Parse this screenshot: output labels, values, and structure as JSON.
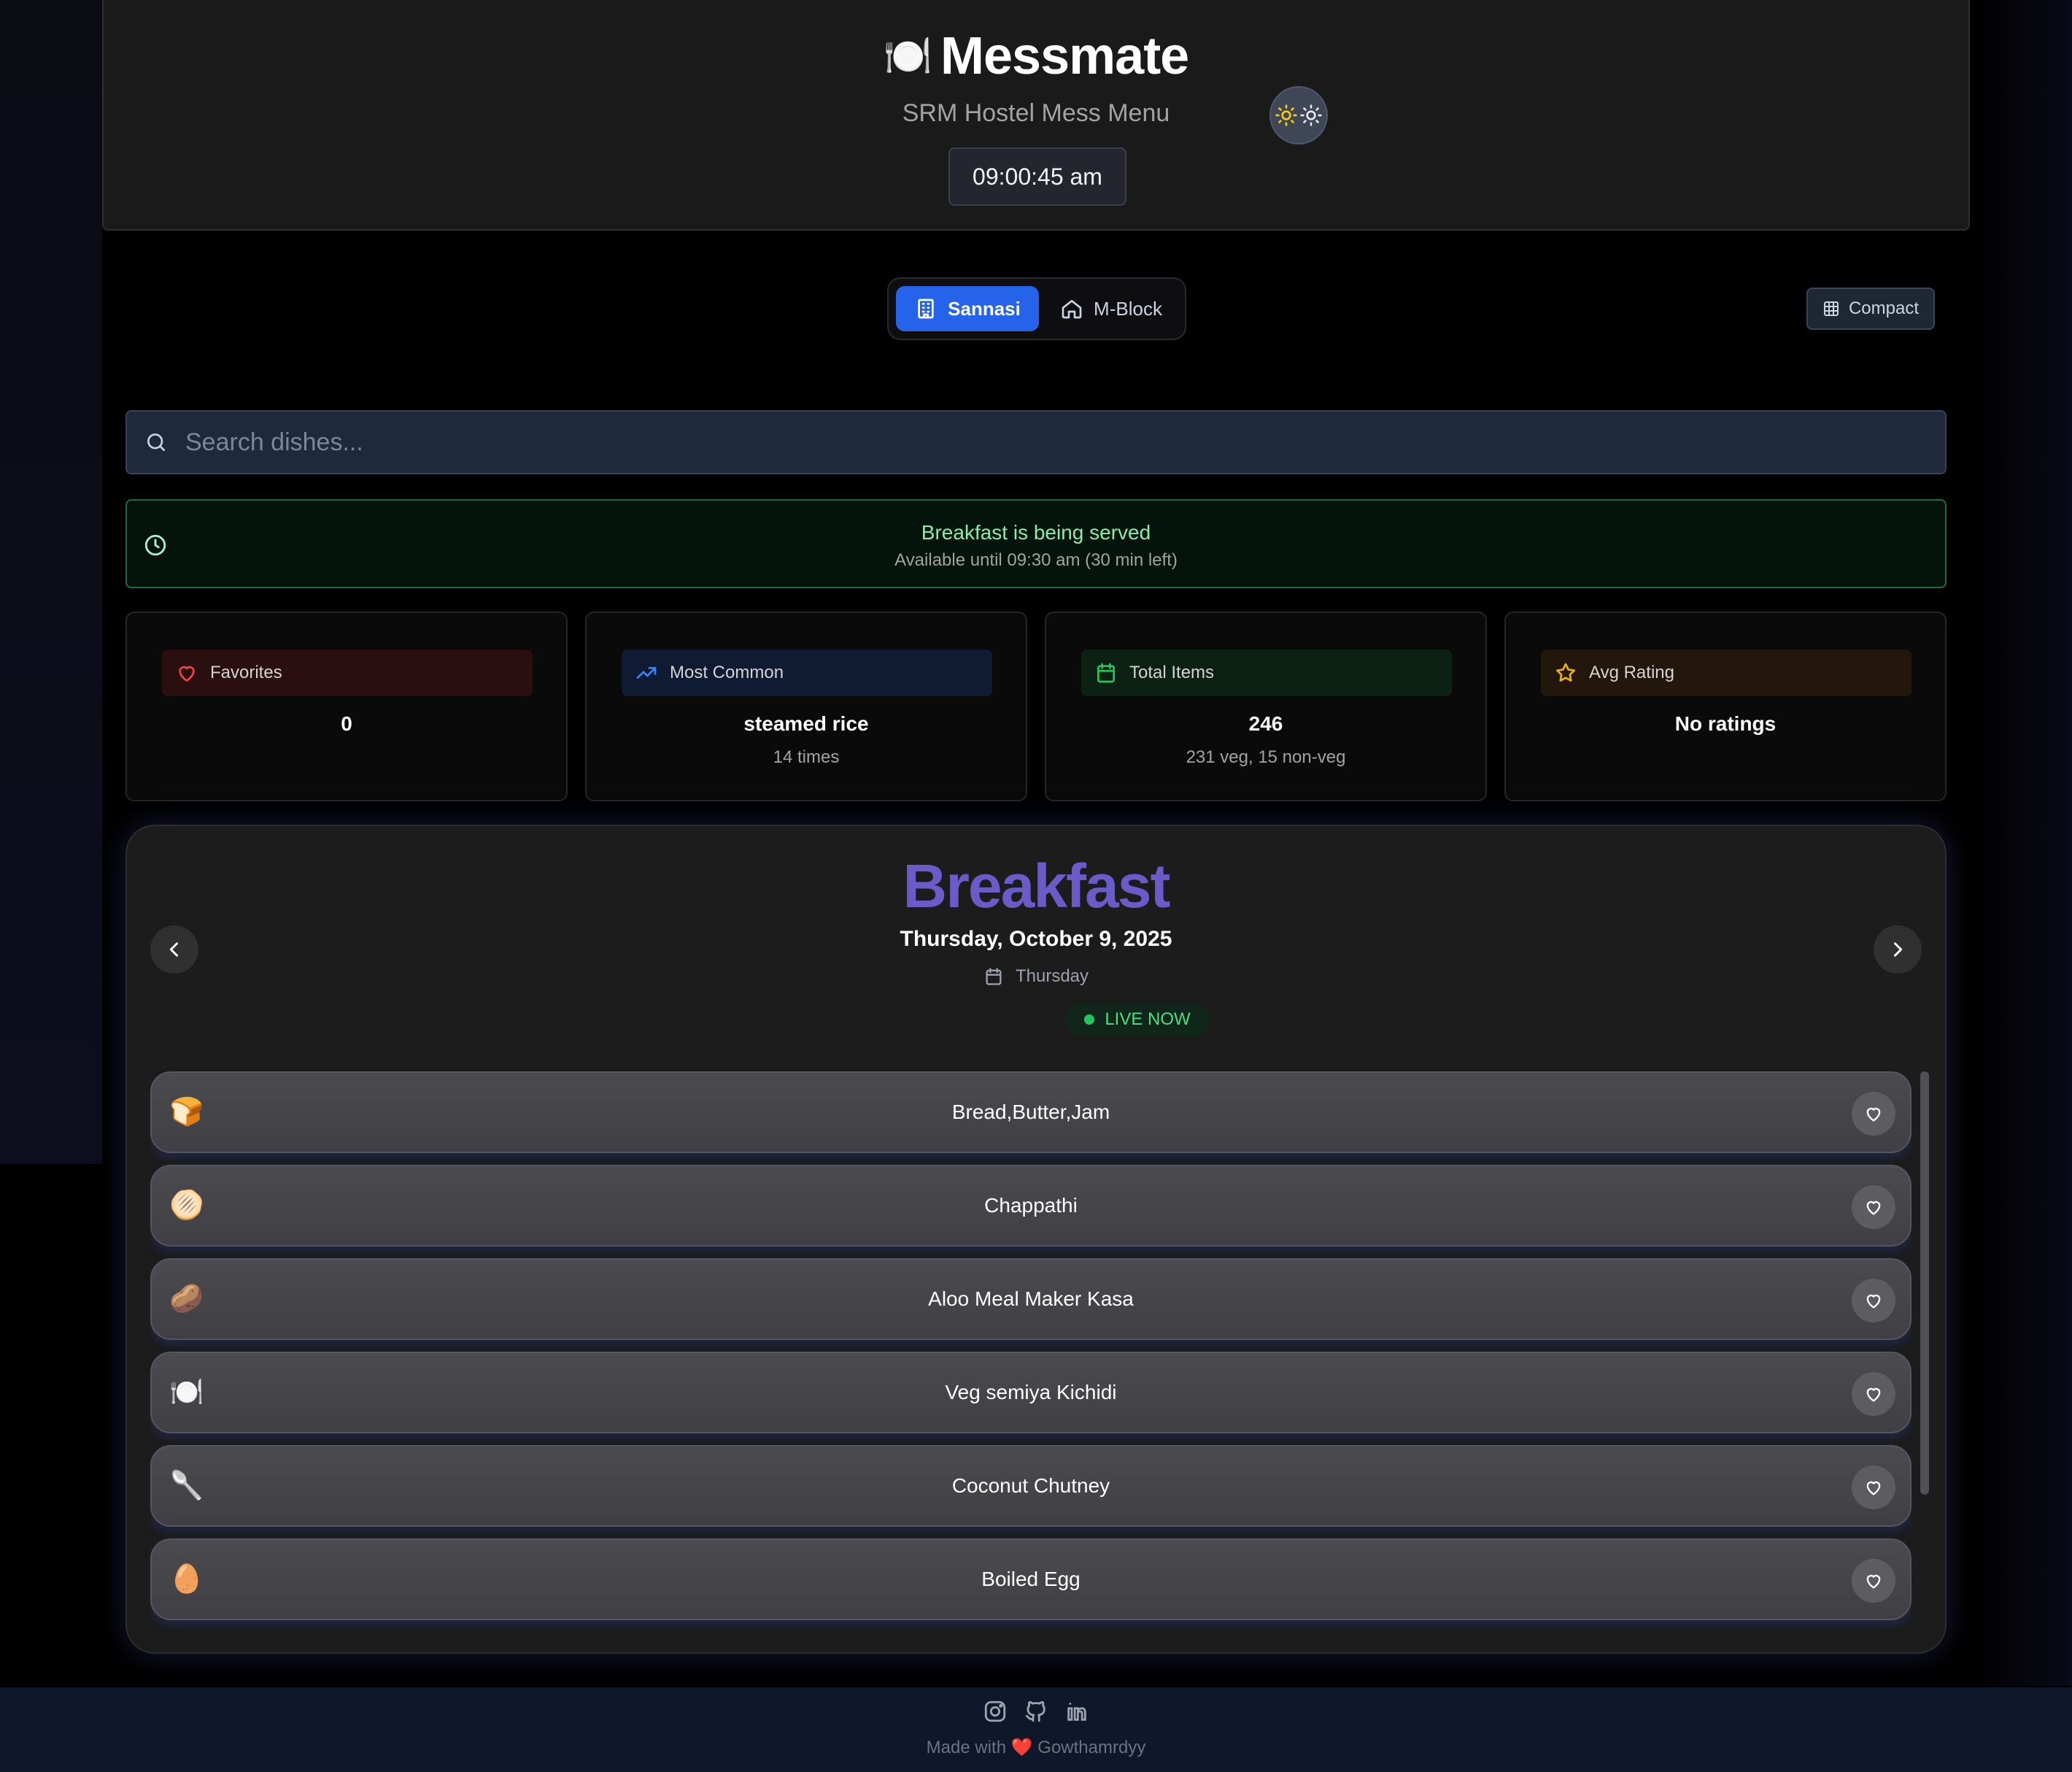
{
  "header": {
    "title": "Messmate",
    "title_icon": "🍽️",
    "subtitle": "SRM Hostel Mess Menu",
    "clock": "09:00:45 am",
    "theme_icon": "sun-icon"
  },
  "mess_selector": {
    "options": [
      {
        "label": "Sannasi",
        "icon": "building-icon",
        "active": true
      },
      {
        "label": "M-Block",
        "icon": "home-icon",
        "active": false
      }
    ],
    "view_toggle_label": "Compact"
  },
  "search": {
    "placeholder": "Search dishes..."
  },
  "serving": {
    "title": "Breakfast is being served",
    "subtitle": "Available until 09:30 am (30 min left)"
  },
  "stats": [
    {
      "label": "Favorites",
      "value": "0",
      "note": "",
      "icon": "heart-icon",
      "color": "#ef4444"
    },
    {
      "label": "Most Common",
      "value": "steamed rice",
      "note": "14 times",
      "icon": "trending-up-icon",
      "color": "#3b82f6"
    },
    {
      "label": "Total Items",
      "value": "246",
      "note": "231 veg, 15 non-veg",
      "icon": "calendar-icon",
      "color": "#22c55e"
    },
    {
      "label": "Avg Rating",
      "value": "No ratings",
      "note": "",
      "icon": "star-icon",
      "color": "#eab308"
    }
  ],
  "meal": {
    "name": "Breakfast",
    "date": "Thursday, October 9, 2025",
    "day": "Thursday",
    "status": "LIVE NOW",
    "items": [
      {
        "emoji": "🍞",
        "name": "Bread,Butter,Jam"
      },
      {
        "emoji": "🫓",
        "name": "Chappathi"
      },
      {
        "emoji": "🥔",
        "name": "Aloo Meal Maker Kasa"
      },
      {
        "emoji": "🍽️",
        "name": "Veg semiya Kichidi"
      },
      {
        "emoji": "🥄",
        "name": "Coconut Chutney"
      },
      {
        "emoji": "🥚",
        "name": "Boiled Egg"
      }
    ]
  },
  "footer": {
    "icons": [
      "instagram-icon",
      "github-icon",
      "linkedin-icon"
    ],
    "made_with": "Made with",
    "heart": "❤️",
    "author": "Gowthamrdyy"
  },
  "colors": {
    "accent": "#2563eb",
    "meal_title": "#6b5bc9",
    "live": "#22c55e"
  }
}
